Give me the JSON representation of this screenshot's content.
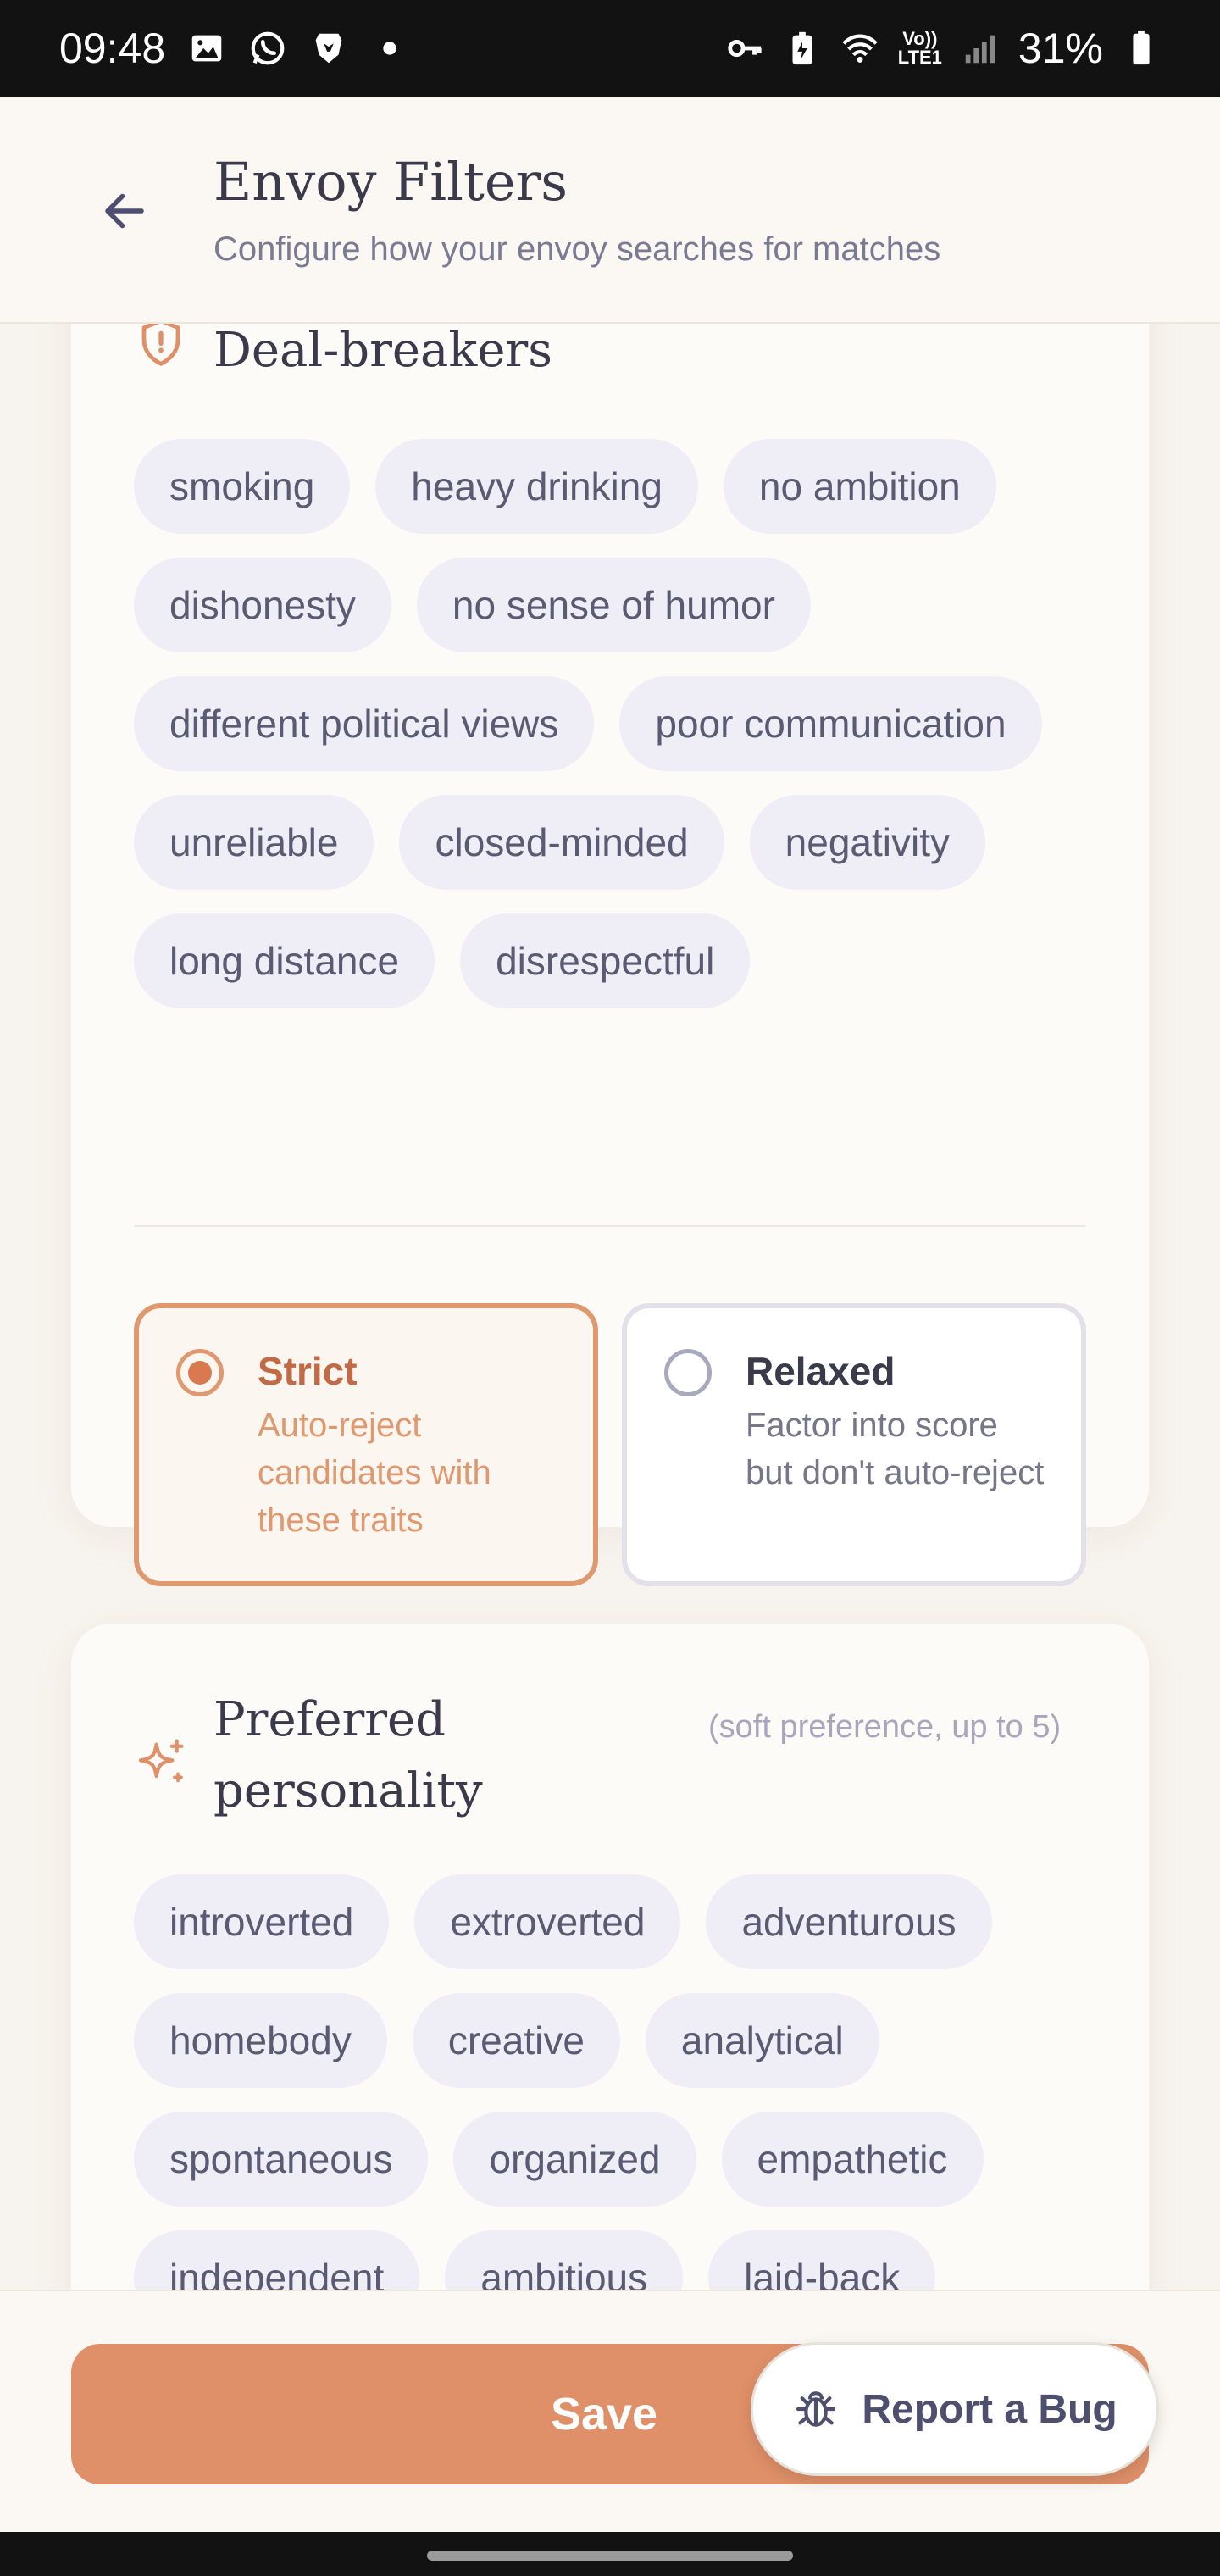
{
  "status_bar": {
    "time": "09:48",
    "battery": "31%",
    "network_label_top": "Vo))",
    "network_label_bottom": "LTE1"
  },
  "header": {
    "title": "Envoy Filters",
    "subtitle": "Configure how your envoy searches for matches",
    "back_icon": "arrow-left-icon"
  },
  "dealbreakers": {
    "title": "Deal-breakers",
    "icon": "shield-alert-icon",
    "chips": [
      "smoking",
      "heavy drinking",
      "no ambition",
      "dishonesty",
      "no sense of humor",
      "different political views",
      "poor communication",
      "unreliable",
      "closed-minded",
      "negativity",
      "long distance",
      "disrespectful"
    ],
    "modes": {
      "strict": {
        "title": "Strict",
        "description": "Auto-reject candidates with these traits",
        "selected": true
      },
      "relaxed": {
        "title": "Relaxed",
        "description": "Factor into score but don't auto-reject",
        "selected": false
      }
    }
  },
  "personality": {
    "title": "Preferred personality",
    "hint": "(soft preference, up to 5)",
    "icon": "sparkle-icon",
    "chips": [
      "introverted",
      "extroverted",
      "adventurous",
      "homebody",
      "creative",
      "analytical",
      "spontaneous",
      "organized",
      "empathetic",
      "independent",
      "ambitious",
      "laid-back"
    ]
  },
  "footer": {
    "save_label": "Save",
    "report_bug_label": "Report a Bug",
    "bug_icon": "bug-icon"
  },
  "colors": {
    "accent": "#df9068",
    "chip_bg": "#efedf5",
    "background": "#f7f3ee"
  }
}
